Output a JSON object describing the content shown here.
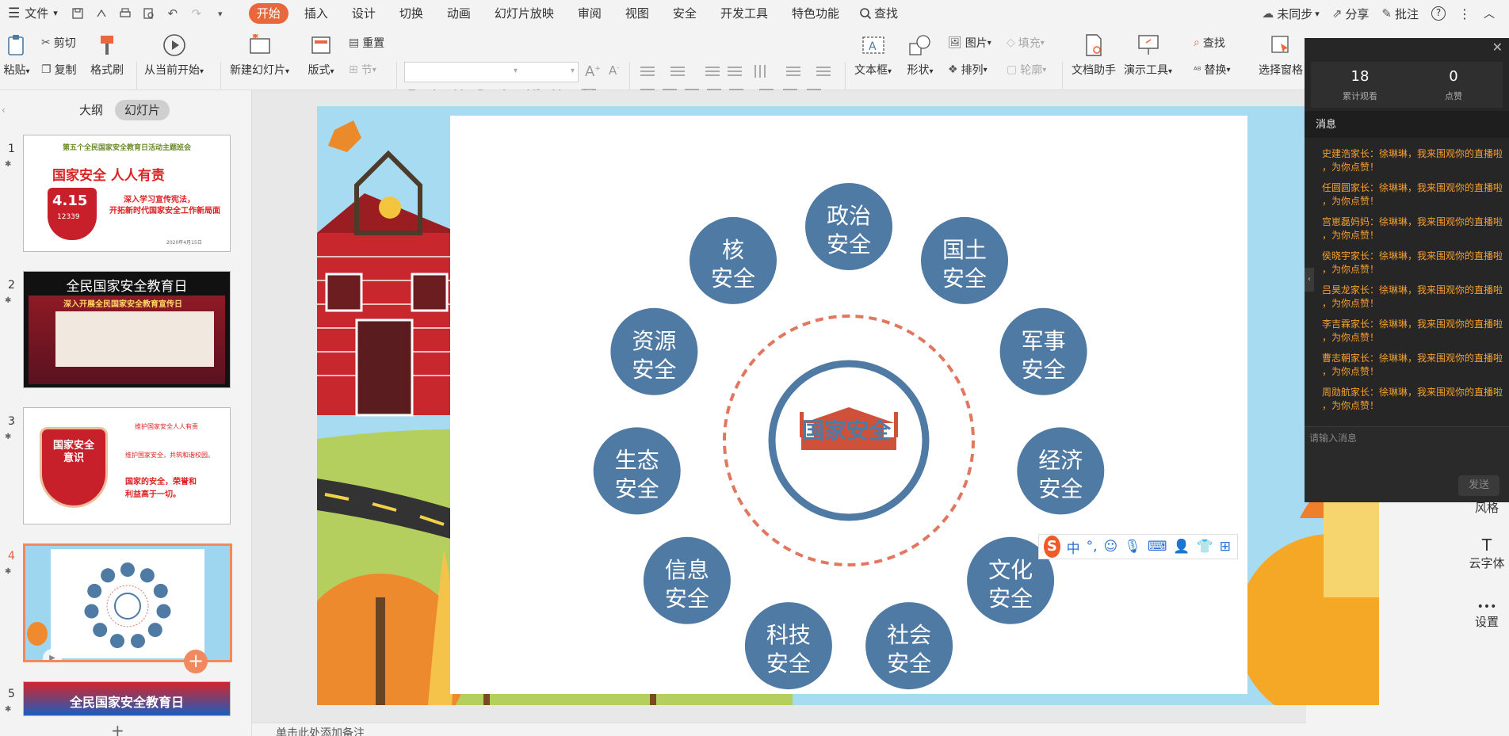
{
  "menu": {
    "file_label": "文件",
    "tabs": [
      {
        "label": "开始",
        "active": true
      },
      {
        "label": "插入"
      },
      {
        "label": "设计"
      },
      {
        "label": "切换"
      },
      {
        "label": "动画"
      },
      {
        "label": "幻灯片放映"
      },
      {
        "label": "审阅"
      },
      {
        "label": "视图"
      },
      {
        "label": "安全"
      },
      {
        "label": "开发工具"
      },
      {
        "label": "特色功能"
      }
    ],
    "search_label": "查找",
    "sync_label": "未同步",
    "share_label": "分享",
    "comment_label": "批注"
  },
  "ribbon": {
    "paste": "粘贴",
    "cut": "剪切",
    "copy": "复制",
    "format_painter": "格式刷",
    "from_current": "从当前开始",
    "new_slide": "新建幻灯片",
    "layout": "版式",
    "reset": "重置",
    "section": "节",
    "textbox": "文本框",
    "shape": "形状",
    "picture": "图片",
    "fill": "填充",
    "arrange": "排列",
    "outline": "轮廓",
    "doc_assistant": "文档助手",
    "present_tools": "演示工具",
    "find": "查找",
    "replace": "替换",
    "select_pane": "选择窗格"
  },
  "left_panel": {
    "outline_tab": "大纲",
    "slides_tab": "幻灯片",
    "slides": [
      {
        "num": "1",
        "title": "第五个全民国家安全教育日活动主题班会",
        "headline": "国家安全 人人有责",
        "badge": "4.15",
        "phone": "12339",
        "sub1": "深入学习宣传宪法，",
        "sub2": "开拓新时代国家安全工作新局面",
        "date": "2020年4月15日"
      },
      {
        "num": "2",
        "title": "全民国家安全教育日",
        "sub": "深入开展全民国家安全教育宣传日"
      },
      {
        "num": "3",
        "line1": "维护国家安全人人有责",
        "line2": "维护国家安全，共筑和谐校园。",
        "line3": "国家的安全，荣誉和",
        "line4": "利益高于一切。",
        "shield": "国家安全意识"
      },
      {
        "num": "4",
        "current": true
      },
      {
        "num": "5",
        "title": "全民国家安全教育日"
      }
    ]
  },
  "slide": {
    "center_label": "国家安全",
    "nodes": [
      {
        "l1": "政治",
        "l2": "安全"
      },
      {
        "l1": "国土",
        "l2": "安全"
      },
      {
        "l1": "军事",
        "l2": "安全"
      },
      {
        "l1": "经济",
        "l2": "安全"
      },
      {
        "l1": "文化",
        "l2": "安全"
      },
      {
        "l1": "社会",
        "l2": "安全"
      },
      {
        "l1": "科技",
        "l2": "安全"
      },
      {
        "l1": "信息",
        "l2": "安全"
      },
      {
        "l1": "生态",
        "l2": "安全"
      },
      {
        "l1": "资源",
        "l2": "安全"
      },
      {
        "l1": "核",
        "l2": "安全"
      }
    ],
    "colors": {
      "node": "#4f7aa4",
      "accent": "#d0513a",
      "ring": "#e2775f"
    }
  },
  "notes_placeholder": "单击此处添加备注",
  "right_side": {
    "style": "风格",
    "cloud_font": "云字体",
    "settings": "设置"
  },
  "chat": {
    "views_count": "18",
    "views_label": "累计观看",
    "likes_count": "0",
    "likes_label": "点赞",
    "messages_title": "消息",
    "messages": [
      {
        "l1": "史建浩家长：徐琳琳，我来围观你的直播啦",
        "l2": "，为你点赞！"
      },
      {
        "l1": "任圆圆家长：徐琳琳，我来围观你的直播啦",
        "l2": "，为你点赞！"
      },
      {
        "l1": "宫崽磊妈妈：徐琳琳，我来围观你的直播啦",
        "l2": "，为你点赞！"
      },
      {
        "l1": "侯晓宇家长：徐琳琳，我来围观你的直播啦",
        "l2": "，为你点赞！"
      },
      {
        "l1": "吕昊龙家长：徐琳琳，我来围观你的直播啦",
        "l2": "，为你点赞！"
      },
      {
        "l1": "李吉霖家长：徐琳琳，我来围观你的直播啦",
        "l2": "，为你点赞！"
      },
      {
        "l1": "曹志朝家长：徐琳琳，我来围观你的直播啦",
        "l2": "，为你点赞！"
      },
      {
        "l1": "周勋航家长：徐琳琳，我来围观你的直播啦",
        "l2": "，为你点赞！"
      }
    ],
    "input_placeholder": "请输入消息",
    "send_label": "发送"
  },
  "ime": {
    "chinese": "中",
    "punct": "°,"
  }
}
